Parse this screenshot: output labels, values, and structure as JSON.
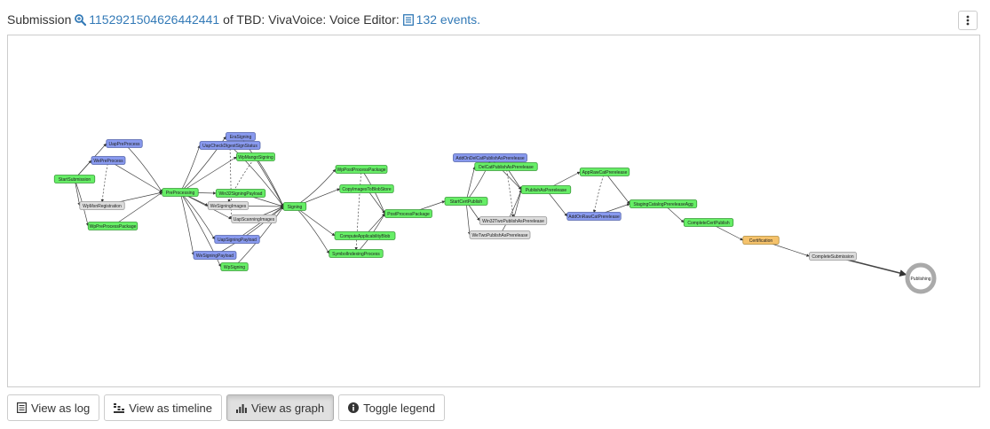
{
  "header": {
    "prefix": "Submission",
    "submission_id": "1152921504626442441",
    "of_text": "of TBD: VivaVoice: Voice Editor:",
    "events_link": "132 events."
  },
  "colors": {
    "green": "#66ee66",
    "blue": "#8899ee",
    "gray": "#dcdcdc",
    "orange": "#f5c26b",
    "link": "#337ab7"
  },
  "graph": {
    "nodes": [
      {
        "id": "StartSubmission",
        "label": "StartSubmission",
        "c": "green"
      },
      {
        "id": "UapPreProcess",
        "label": "UapPreProcess",
        "c": "blue"
      },
      {
        "id": "WePreProcess",
        "label": "WePreProcess",
        "c": "blue"
      },
      {
        "id": "WpMsnRegistration",
        "label": "WpMsnRegistration",
        "c": "gray"
      },
      {
        "id": "WpPreProcessPackage",
        "label": "WpPreProcessPackage",
        "c": "green"
      },
      {
        "id": "PreProcessing",
        "label": "PreProcessing",
        "c": "green"
      },
      {
        "id": "EraSigning",
        "label": "EraSigning",
        "c": "blue"
      },
      {
        "id": "UapCheckDigestSignStatus",
        "label": "UapCheckDigestSignStatus",
        "c": "blue"
      },
      {
        "id": "WpMangoSigning",
        "label": "WpMangoSigning",
        "c": "green"
      },
      {
        "id": "Win32SigningPayload",
        "label": "Win32SigningPayload",
        "c": "green"
      },
      {
        "id": "WeSigningImages",
        "label": "WeSigningImages",
        "c": "gray"
      },
      {
        "id": "UapScanningImages",
        "label": "UapScanningImages",
        "c": "gray"
      },
      {
        "id": "UapSigningPayload",
        "label": "UapSigningPayload",
        "c": "blue"
      },
      {
        "id": "WeSigningPayload",
        "label": "WeSigningPayload",
        "c": "blue"
      },
      {
        "id": "WpSigning",
        "label": "WpSigning",
        "c": "green"
      },
      {
        "id": "Signing",
        "label": "Signing",
        "c": "green"
      },
      {
        "id": "WpPostProcessPackage",
        "label": "WpPostProcessPackage",
        "c": "green"
      },
      {
        "id": "CopyImagesToBlobStore",
        "label": "CopyImagesToBlobStore",
        "c": "green"
      },
      {
        "id": "ComputeApplicabilityBlob",
        "label": "ComputeApplicabilityBlob",
        "c": "green"
      },
      {
        "id": "SymbolIndexingProcess",
        "label": "SymbolIndexingProcess",
        "c": "green"
      },
      {
        "id": "PostProcessPackage",
        "label": "PostProcessPackage",
        "c": "green"
      },
      {
        "id": "StartCertPublish",
        "label": "StartCertPublish",
        "c": "green"
      },
      {
        "id": "AddOnDelCatPublishAsPrerelease",
        "label": "AddOnDelCatPublishAsPrerelease",
        "c": "blue"
      },
      {
        "id": "DelCatPublishAsPrerelease",
        "label": "DelCatPublishAsPrerelease",
        "c": "green"
      },
      {
        "id": "PublishAsPrerelease",
        "label": "PublishAsPrerelease",
        "c": "green"
      },
      {
        "id": "Win32TwoPublishAsPrerelease",
        "label": "Win32TwoPublishAsPrerelease",
        "c": "gray"
      },
      {
        "id": "WeTwoPublishAsPrerelease",
        "label": "WeTwoPublishAsPrerelease",
        "c": "gray"
      },
      {
        "id": "AppRawCatPrerelease",
        "label": "AppRawCatPrerelease",
        "c": "green"
      },
      {
        "id": "AddOnRawCatPrerelease",
        "label": "AddOnRawCatPrerelease",
        "c": "blue"
      },
      {
        "id": "StagingCatalogPrereleaseAgg",
        "label": "StagingCatalogPrereleaseAgg",
        "c": "green"
      },
      {
        "id": "CompleteCertPublish",
        "label": "CompleteCertPublish",
        "c": "green"
      },
      {
        "id": "Certification",
        "label": "Certification",
        "c": "orange"
      },
      {
        "id": "CompleteSubmission",
        "label": "CompleteSubmission",
        "c": "gray"
      },
      {
        "id": "Publishing",
        "label": "Publishing",
        "c": "circle"
      }
    ]
  },
  "buttons": [
    {
      "label": "View as log",
      "icon": "list-icon"
    },
    {
      "label": "View as timeline",
      "icon": "timeline-icon"
    },
    {
      "label": "View as graph",
      "icon": "graph-icon"
    },
    {
      "label": "Toggle legend",
      "icon": "info-icon"
    }
  ]
}
